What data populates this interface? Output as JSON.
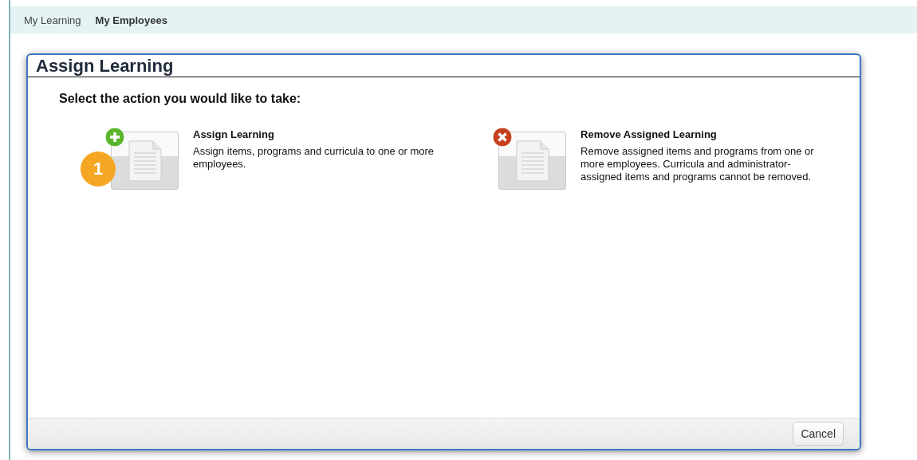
{
  "nav": {
    "tabs": [
      {
        "label": "My Learning",
        "selected": false
      },
      {
        "label": "My Employees",
        "selected": true
      }
    ]
  },
  "dialog": {
    "title": "Assign Learning",
    "prompt": "Select the action you would like to take:",
    "options": [
      {
        "kind": "add",
        "title": "Assign Learning",
        "description": "Assign items, programs and curricula to one or more employees.",
        "callout": "1"
      },
      {
        "kind": "remove",
        "title": "Remove Assigned Learning",
        "description": "Remove assigned items and programs from one or more employees. Curricula and administrator-assigned items and programs cannot be removed."
      }
    ],
    "buttons": [
      "Cancel"
    ]
  }
}
